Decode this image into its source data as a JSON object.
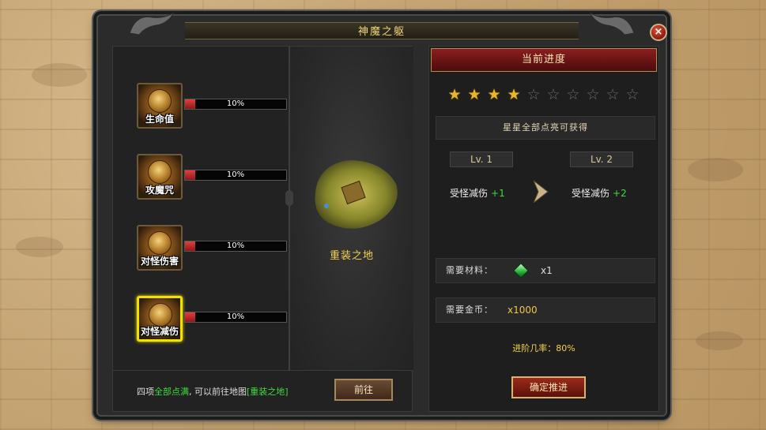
{
  "window": {
    "title": "神魔之躯"
  },
  "skills": [
    {
      "name": "生命值",
      "progress": "10%",
      "fill": 0.1
    },
    {
      "name": "攻魔咒",
      "progress": "10%",
      "fill": 0.1
    },
    {
      "name": "对怪伤害",
      "progress": "10%",
      "fill": 0.1
    },
    {
      "name": "对怪减伤",
      "progress": "10%",
      "fill": 0.1,
      "selected": true
    }
  ],
  "map": {
    "name": "重装之地"
  },
  "hint": {
    "prefix": "四项",
    "highlight": "全部点满",
    "middle": ", 可以前往地图",
    "map_link": "[重装之地]"
  },
  "buttons": {
    "goto": "前往",
    "confirm": "确定推进"
  },
  "progress_panel": {
    "header": "当前进度",
    "stars_lit": 4,
    "stars_total": 10,
    "reward_text": "星星全部点亮可获得",
    "current_level": "Lv. 1",
    "next_level": "Lv. 2",
    "current_stat": {
      "label": "受怪减伤",
      "value": "+1"
    },
    "next_stat": {
      "label": "受怪减伤",
      "value": "+2"
    },
    "material_label": "需要材料：",
    "material_qty": "x1",
    "gold_label": "需要金币：",
    "gold_qty": "x1000",
    "rate_text": "进阶几率：80%"
  },
  "colors": {
    "accent_gold": "#f3d34a",
    "green": "#3ddc3d",
    "header_red": "#8b1e1e"
  }
}
